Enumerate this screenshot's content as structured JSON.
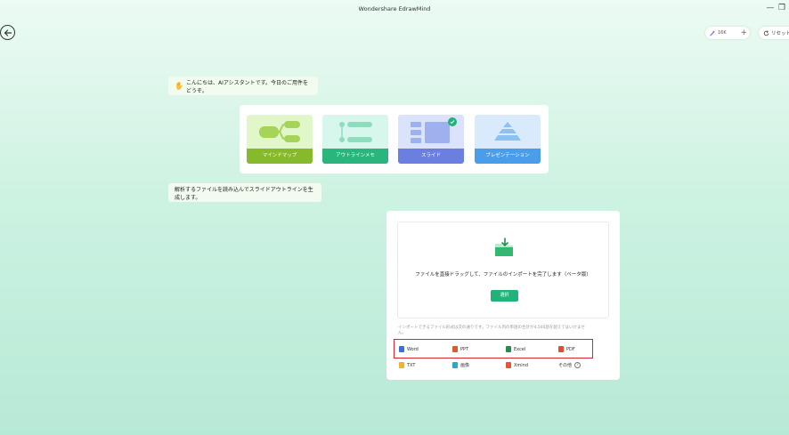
{
  "window": {
    "title": "Wondershare EdrawMind"
  },
  "header": {
    "credits": "16K",
    "reset_label": "リセット"
  },
  "chat": {
    "greeting": "こんにちは、AIアシスタントです。今日のご用件をどうぞ。",
    "hint": "解析するファイルを読み込んでスライドアウトラインを生成します。"
  },
  "modes": [
    {
      "label": "マインドマップ",
      "icon": "mindmap-icon"
    },
    {
      "label": "アウトラインメモ",
      "icon": "outline-icon"
    },
    {
      "label": "スライド",
      "icon": "slide-icon",
      "selected": true
    },
    {
      "label": "プレゼンテーション",
      "icon": "presentation-icon"
    }
  ],
  "import": {
    "drop_text": "ファイルを直接ドラッグして、ファイルのインポートを完了します（ベータ版）",
    "select_label": "選択",
    "support_note": "インポートできるファイル形式は次の通りです。ファイル内の単語の合計が4,500語を超えてはいけません。",
    "formats": [
      {
        "label": "Word",
        "color": "#3d6fd8"
      },
      {
        "label": "PPT",
        "color": "#e2572e"
      },
      {
        "label": "Excel",
        "color": "#1f8f4e"
      },
      {
        "label": "PDF",
        "color": "#e24a3b"
      }
    ],
    "formats_more": [
      {
        "label": "TXT",
        "color": "#f2b32b"
      },
      {
        "label": "画像",
        "color": "#28a9c9"
      },
      {
        "label": "Xmind",
        "color": "#e8543a"
      }
    ],
    "others_label": "その他"
  },
  "colors": {
    "accent": "#1fb37a",
    "highlight_border": "#d9252e"
  }
}
